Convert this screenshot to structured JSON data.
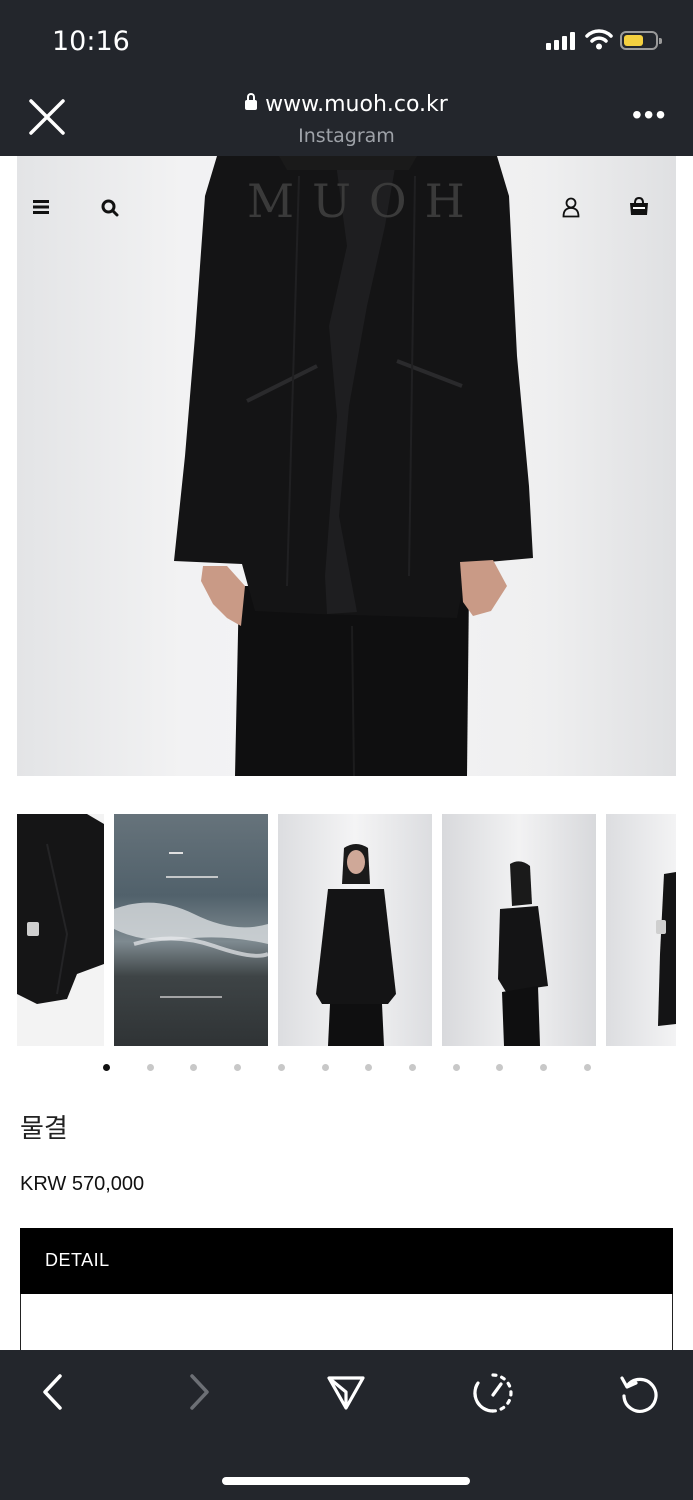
{
  "status_bar": {
    "time": "10:16"
  },
  "browser": {
    "url": "www.muoh.co.kr",
    "source": "Instagram",
    "close_icon": "close-icon",
    "more_icon": "more-horizontal-icon"
  },
  "site_header": {
    "logo": "MUOH",
    "icons": [
      "menu-icon",
      "search-icon",
      "user-icon",
      "shopping-bag-icon"
    ]
  },
  "gallery": {
    "dot_count": 12,
    "active_index": 0
  },
  "product": {
    "name": "물결",
    "price": "KRW 570,000",
    "detail_label": "DETAIL"
  },
  "toolbar": {
    "icons": [
      "back-icon",
      "forward-icon",
      "share-icon",
      "speed-icon",
      "reload-icon"
    ]
  },
  "colors": {
    "chrome": "#23262c",
    "battery": "#f4d03f",
    "detail_bar": "#000000"
  }
}
